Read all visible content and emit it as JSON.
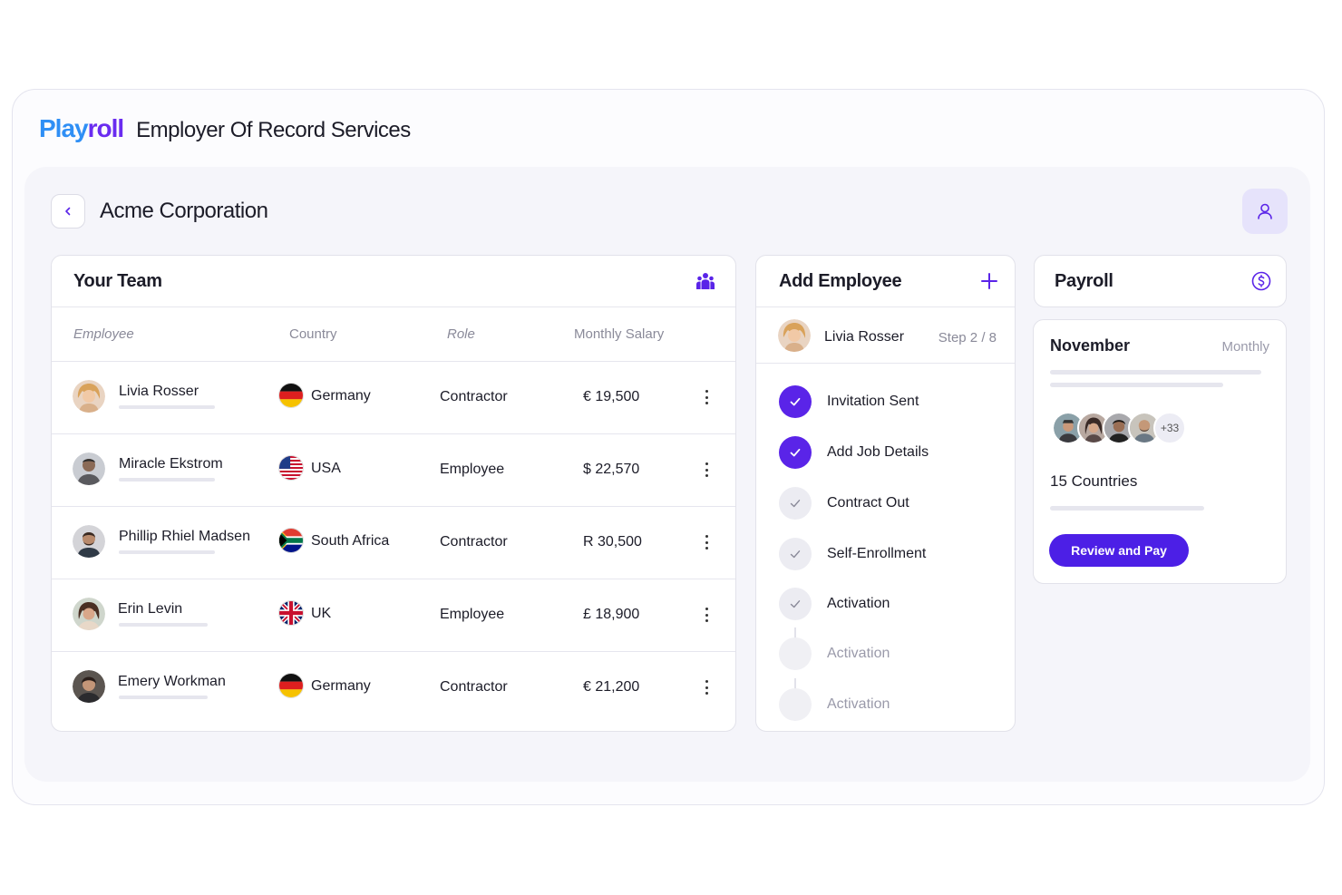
{
  "header": {
    "logo_part1": "Play",
    "logo_part2": "roll",
    "title": "Employer Of Record Services"
  },
  "company": {
    "name": "Acme Corporation"
  },
  "team": {
    "title": "Your Team",
    "columns": [
      "Employee",
      "Country",
      "Role",
      "Monthly Salary"
    ],
    "rows": [
      {
        "name": "Livia Rosser",
        "country": "Germany",
        "role": "Contractor",
        "salary": "€ 19,500"
      },
      {
        "name": "Miracle Ekstrom",
        "country": "USA",
        "role": "Employee",
        "salary": "$ 22,570"
      },
      {
        "name": "Phillip Rhiel Madsen",
        "country": "South Africa",
        "role": "Contractor",
        "salary": "R 30,500"
      },
      {
        "name": "Erin Levin",
        "country": "UK",
        "role": "Employee",
        "salary": "£ 18,900"
      },
      {
        "name": "Emery Workman",
        "country": "Germany",
        "role": "Contractor",
        "salary": "€ 21,200"
      }
    ]
  },
  "add_employee": {
    "title": "Add Employee",
    "employee_name": "Livia Rosser",
    "step": "Step 2 / 8",
    "steps": [
      {
        "label": "Invitation Sent",
        "state": "done"
      },
      {
        "label": "Add Job Details",
        "state": "done"
      },
      {
        "label": "Contract Out",
        "state": "partial"
      },
      {
        "label": "Self-Enrollment",
        "state": "partial"
      },
      {
        "label": "Activation",
        "state": "partial"
      },
      {
        "label": "Activation",
        "state": "pending"
      },
      {
        "label": "Activation",
        "state": "pending"
      }
    ]
  },
  "payroll": {
    "title": "Payroll",
    "month": "November",
    "period": "Monthly",
    "extra_count": "+33",
    "countries": "15 Countries",
    "review_label": "Review and Pay"
  },
  "colors": {
    "accent": "#5a24e8",
    "logo_blue": "#2f8ff5",
    "logo_purple": "#6a2cf0",
    "button": "#4c1fe6"
  }
}
